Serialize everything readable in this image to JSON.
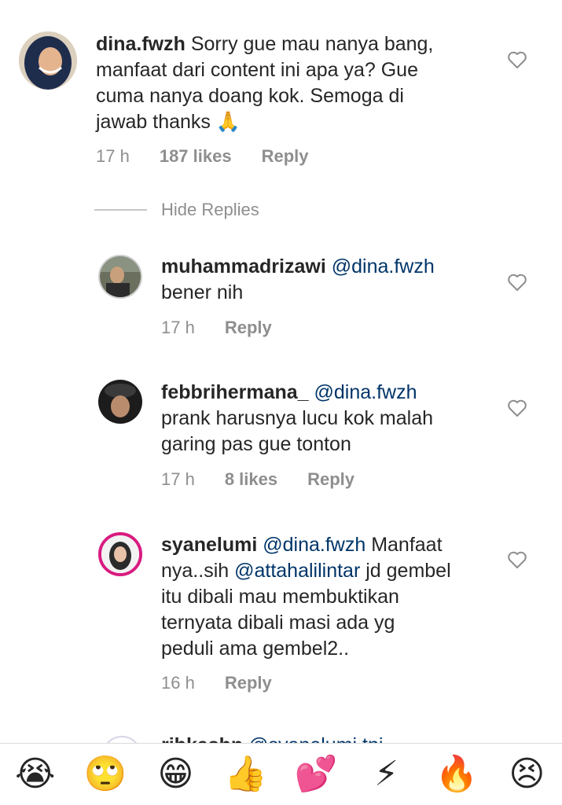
{
  "comments": [
    {
      "username": "dina.fwzh",
      "lines": [
        "Sorry gue mau nanya bang,",
        "manfaat dari content ini apa ya? Gue",
        "cuma nanya doang kok. Semoga di",
        "jawab thanks 🙏"
      ],
      "time": "17 h",
      "likes": "187 likes",
      "reply": "Reply"
    },
    {
      "username": "muhammadrizawi",
      "mention": "@dina.fwzh",
      "lines": [
        "bener nih"
      ],
      "time": "17 h",
      "reply": "Reply"
    },
    {
      "username": "febbrihermana_",
      "mention": "@dina.fwzh",
      "lines": [
        "prank harusnya lucu kok malah",
        "garing pas gue tonton"
      ],
      "time": "17 h",
      "likes": "8 likes",
      "reply": "Reply"
    },
    {
      "username": "syanelumi",
      "mention": "@dina.fwzh",
      "first_tail": "Manfaat",
      "line2_a": "nya..sih ",
      "line2_mention": "@attahalilintar",
      "line2_b": " jd gembel",
      "lines": [
        "itu dibali mau membuktikan",
        "ternyata dibali masi ada yg",
        "peduli ama gembel2.."
      ],
      "time": "16 h",
      "reply": "Reply"
    }
  ],
  "hide_replies": "Hide Replies",
  "peek_username": "ribkashn",
  "peek_mention": "@syanelumi tpi",
  "emoji_bar": [
    "😭",
    "🙄",
    "😁",
    "👍",
    "💕",
    "⚡",
    "🔥",
    "😣"
  ],
  "colors": {
    "mention": "#003569",
    "meta": "#8e8e8e",
    "text": "#262626"
  },
  "icons": {
    "like": "heart-outline-icon"
  }
}
